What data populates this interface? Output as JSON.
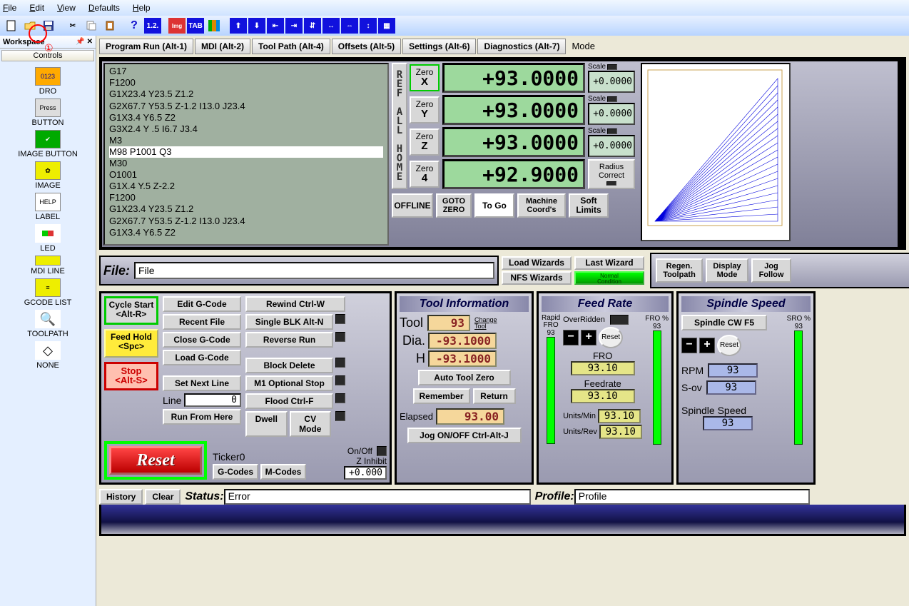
{
  "menu": {
    "file": "File",
    "edit": "Edit",
    "view": "View",
    "defaults": "Defaults",
    "help": "Help"
  },
  "annot": {
    "num": "①"
  },
  "workspace": {
    "title": "Workspace",
    "tab": "Controls",
    "items": [
      {
        "label": "DRO"
      },
      {
        "label": "BUTTON"
      },
      {
        "label": "IMAGE BUTTON"
      },
      {
        "label": "IMAGE"
      },
      {
        "label": "LABEL"
      },
      {
        "label": "LED"
      },
      {
        "label": "MDI LINE"
      },
      {
        "label": "GCODE LIST"
      },
      {
        "label": "TOOLPATH"
      },
      {
        "label": "NONE"
      }
    ]
  },
  "tabs": [
    "Program Run (Alt-1)",
    "MDI (Alt-2)",
    "Tool Path (Alt-4)",
    "Offsets (Alt-5)",
    "Settings (Alt-6)",
    "Diagnostics (Alt-7)"
  ],
  "mode_label": "Mode",
  "gcode": {
    "lines_a": "G17\nF1200\nG1X23.4 Y23.5 Z1.2\nG2X67.7 Y53.5 Z-1.2 I13.0 J23.4\nG1X3.4 Y6.5 Z2\nG3X2.4 Y .5 I6.7 J3.4\nM3",
    "hl": "M98 P1001 Q3",
    "lines_b": "M30\nO1001\nG1X.4 Y.5 Z-2.2\nF1200\nG1X23.4 Y23.5 Z1.2\nG2X67.7 Y53.5 Z-1.2 I13.0 J23.4\nG1X3.4 Y6.5 Z2"
  },
  "refall": "R\nE\nF\n \nA\nL\nL\n \nH\nO\nM\nE",
  "axes": [
    {
      "name": "X",
      "zero": "Zero",
      "dro": "+93.0000",
      "scale_lbl": "Scale",
      "scale": "+0.0000"
    },
    {
      "name": "Y",
      "zero": "Zero",
      "dro": "+93.0000",
      "scale_lbl": "Scale",
      "scale": "+0.0000"
    },
    {
      "name": "Z",
      "zero": "Zero",
      "dro": "+93.0000",
      "scale_lbl": "Scale",
      "scale": "+0.0000"
    },
    {
      "name": "4",
      "zero": "Zero",
      "dro": "+92.9000",
      "rad_a": "Radius",
      "rad_b": "Correct"
    }
  ],
  "dro_btns": {
    "offline": "OFFLINE",
    "gotozero": "GOTO\nZERO",
    "togo": "To Go",
    "machine": "Machine\nCoord's",
    "soft": "Soft\nLimits"
  },
  "file": {
    "label": "File:",
    "value": "File"
  },
  "wiz": {
    "load": "Load Wizards",
    "last": "Last Wizard",
    "nfs": "NFS Wizards",
    "norm": "Normal\nCondition",
    "regen": "Regen.\nToolpath",
    "disp": "Display\nMode",
    "jog": "Jog\nFollow"
  },
  "run": {
    "cycle": "Cycle Start\n<Alt-R>",
    "fhold": "Feed Hold\n<Spc>",
    "stop": "Stop\n<Alt-S>",
    "edit": "Edit G-Code",
    "recent": "Recent File",
    "close": "Close G-Code",
    "load": "Load G-Code",
    "setnext": "Set Next Line",
    "runfrom": "Run From Here",
    "rewind": "Rewind Ctrl-W",
    "single": "Single BLK Alt-N",
    "reverse": "Reverse Run",
    "block": "Block Delete",
    "m1opt": "M1 Optional Stop",
    "flood": "Flood Ctrl-F",
    "dwell": "Dwell",
    "cvmode": "CV Mode",
    "line_lbl": "Line",
    "line_val": "0",
    "onoff": "On/Off",
    "zinh": "Z Inhibit",
    "zinh_val": "+0.000"
  },
  "reset": {
    "btn": "Reset",
    "ticker": "Ticker0",
    "gcodes": "G-Codes",
    "mcodes": "M-Codes"
  },
  "tool": {
    "head": "Tool Information",
    "tool_lbl": "Tool",
    "tool_val": "93",
    "change": "Change\nTool",
    "dia_lbl": "Dia.",
    "dia_val": "-93.1000",
    "h_lbl": "H",
    "h_val": "-93.1000",
    "auto": "Auto Tool Zero",
    "remember": "Remember",
    "return": "Return",
    "elapsed_lbl": "Elapsed",
    "elapsed_val": "93.00",
    "jog": "Jog ON/OFF Ctrl-Alt-J"
  },
  "feed": {
    "head": "Feed Rate",
    "over": "OverRidden",
    "fro_pct": "FRO %",
    "fro_pct_v": "93",
    "rapid": "Rapid\nFRO",
    "rapid_v": "93",
    "reset": "Reset",
    "fro_lbl": "FRO",
    "fro_v": "93.10",
    "fr_lbl": "Feedrate",
    "fr_v": "93.10",
    "umin": "Units/Min",
    "umin_v": "93.10",
    "urev": "Units/Rev",
    "urev_v": "93.10"
  },
  "spin": {
    "head": "Spindle Speed",
    "sro_pct": "SRO %",
    "sro_v": "93",
    "cw": "Spindle CW F5",
    "reset": "Reset",
    "rpm": "RPM",
    "rpm_v": "93",
    "sov": "S-ov",
    "sov_v": "93",
    "ss_lbl": "Spindle Speed",
    "ss_v": "93"
  },
  "status": {
    "history": "History",
    "clear": "Clear",
    "slbl": "Status:",
    "sval": "Error",
    "plbl": "Profile:",
    "pval": "Profile"
  }
}
